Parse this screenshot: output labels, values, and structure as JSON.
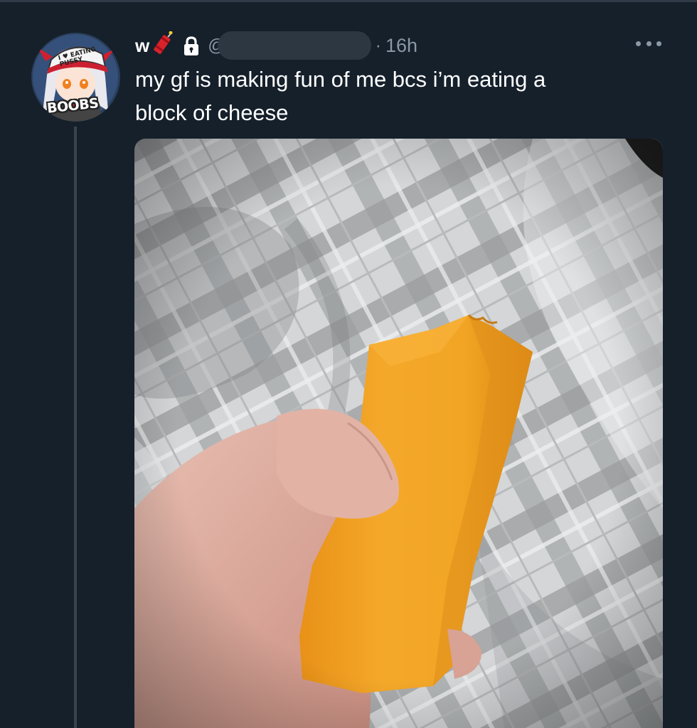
{
  "tweet": {
    "author": {
      "display_name": "w",
      "name_emoji_icon": "firecracker-icon",
      "protected_icon": "lock-icon",
      "handle_prefix": "@",
      "avatar_badge_text": "BOOBS",
      "avatar_hat_text": "I ♥ EATING PUSSY"
    },
    "separator": "·",
    "timestamp": "16h",
    "more_icon": "more-dots-icon",
    "text_line_1": "my gf is making fun of me bcs i’m eating a",
    "text_line_2": "block of cheese",
    "media": {
      "alt_subject": "hand holding a bitten block of cheddar cheese over a grey plaid blanket"
    }
  },
  "colors": {
    "background": "#15202b",
    "text_primary": "#ffffff",
    "text_secondary": "#8b98a5",
    "thread_line": "#38444d",
    "cheese": "#f0a020"
  }
}
